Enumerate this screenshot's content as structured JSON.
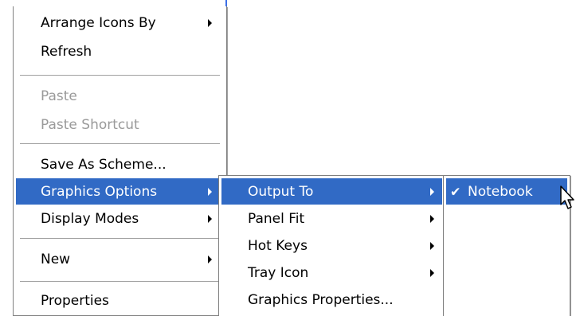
{
  "context_menu": {
    "items": [
      {
        "label": "Arrange Icons By"
      },
      {
        "label": "Refresh"
      },
      {
        "label": "Paste"
      },
      {
        "label": "Paste Shortcut"
      },
      {
        "label": "Save As Scheme..."
      },
      {
        "label": "Graphics Options"
      },
      {
        "label": "Display Modes"
      },
      {
        "label": "New"
      },
      {
        "label": "Properties"
      }
    ]
  },
  "graphics_submenu": {
    "items": [
      {
        "label": "Output To"
      },
      {
        "label": "Panel Fit"
      },
      {
        "label": "Hot Keys"
      },
      {
        "label": "Tray Icon"
      },
      {
        "label": "Graphics Properties..."
      }
    ]
  },
  "output_submenu": {
    "items": [
      {
        "label": "Notebook",
        "checked": true
      }
    ],
    "check_glyph": "✔"
  },
  "colors": {
    "highlight": "#316ac5",
    "disabled_text": "#9a9a9a",
    "window_edge": "#3a6ee8"
  },
  "icons": {
    "submenu_arrow": "chevron-right-icon",
    "check": "check-icon",
    "cursor": "mouse-pointer-icon"
  }
}
